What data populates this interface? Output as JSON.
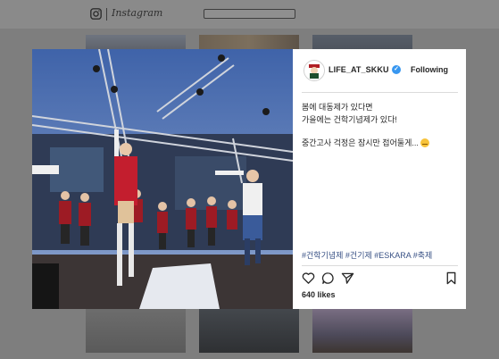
{
  "header": {
    "logo_icon": "instagram-icon",
    "logo_text": "Instagram",
    "search_placeholder": ""
  },
  "post": {
    "username": "LIFE_AT_SKKU",
    "verified_icon": "verified-badge-icon",
    "follow_label": "Following",
    "caption_lines": [
      "봄에 대동제가 있다면",
      "가을에는 건학기념제가 있다!",
      "중간고사 걱정은 잠시만 접어둘게..."
    ],
    "emoji_icon": "smiley-icon",
    "hashtags": "#건학기념제 #건기제 #ESKARA #축제",
    "action_icons": [
      "heart-icon",
      "comment-icon",
      "share-icon",
      "bookmark-icon"
    ],
    "likes": "640 likes"
  },
  "colors": {
    "background": "#7e7e7e",
    "card": "#ffffff",
    "verified": "#3897f0",
    "hashtag": "#385185"
  }
}
